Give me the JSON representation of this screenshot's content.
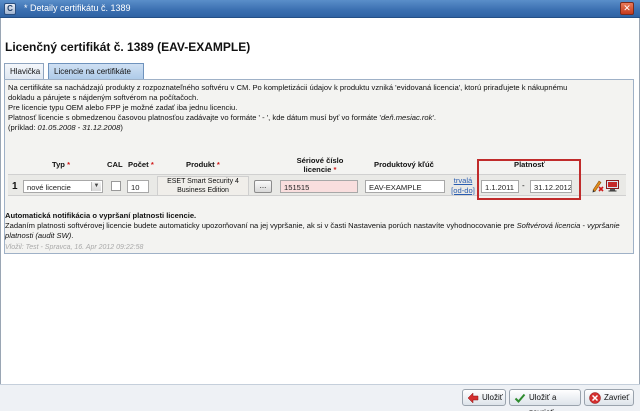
{
  "window": {
    "title": "* Detaily certifikátu č. 1389"
  },
  "page": {
    "heading": "Licenčný certifikát č. 1389 (EAV-EXAMPLE)"
  },
  "tabs": [
    {
      "label": "Hlavička",
      "active": false
    },
    {
      "label": "Licencie na certifikáte",
      "active": true
    }
  ],
  "description": {
    "line1": "Na certifikáte sa nachádzajú produkty z rozpoznateľného softvéru v CM. Po kompletizácii údajov k produktu vzniká 'evidovaná licencia', ktorú priraďujete k nákupnému",
    "line2": "dokladu a párujete s nájdeným softvérom na počítačoch.",
    "line3": "Pre licencie typu OEM alebo FPP je možné zadať iba jednu licenciu.",
    "line4_prefix": "Platnosť licencie s obmedzenou časovou platnosťou zadávajte vo formáte ' - ', kde dátum musí byť vo formáte '",
    "line4_format": "deň.mesiac.rok",
    "line4_suffix": "'.",
    "line5_prefix": "(príklad: ",
    "line5_example": "01.05.2008 - 31.12.2008",
    "line5_suffix": ")"
  },
  "table": {
    "headers": {
      "type": "Typ",
      "cal": "CAL",
      "count": "Počet",
      "product": "Produkt",
      "serial_line1": "Sériové číslo",
      "serial_line2": "licencie",
      "product_key": "Produktový kľúč",
      "validity": "Platnosť",
      "required_mark": "*"
    },
    "row": {
      "number": "1",
      "type_value": "nové licencie",
      "cal_checked": false,
      "count": "10",
      "product_line1": "ESET Smart Security 4",
      "product_line2": "Business Edition",
      "browse_label": "...",
      "serial": "151515",
      "product_key": "EAV-EXAMPLE",
      "permanent_link": "trvalá",
      "range_link": "[od-do]",
      "valid_from": "1.1.2011",
      "separator": "-",
      "valid_to": "31.12.2012"
    }
  },
  "notification": {
    "title": "Automatická notifikácia o vypršaní platnosti licencie.",
    "text_prefix": "Zadaním platnosti softvérovej licencie budete automaticky upozorňovaní na jej vypršanie, ak si v časti Nastavenia porúch nastavíte vyhodnocovanie pre ",
    "text_link1": "Softvérová licencia",
    "text_middle": " - ",
    "text_link2": "vypršanie platnosti (audit SW)",
    "text_suffix": "."
  },
  "footer_note": "Vložil: Test - Spravca, 16. Apr 2012 09:22:58",
  "buttons": {
    "save": "Uložiť",
    "save_close": "Uložiť a zavrieť",
    "close": "Zavrieť"
  },
  "colors": {
    "highlight": "#c02b2b",
    "titlebar": "#3a6fb0",
    "required": "#d01919",
    "link": "#2a5db0"
  }
}
